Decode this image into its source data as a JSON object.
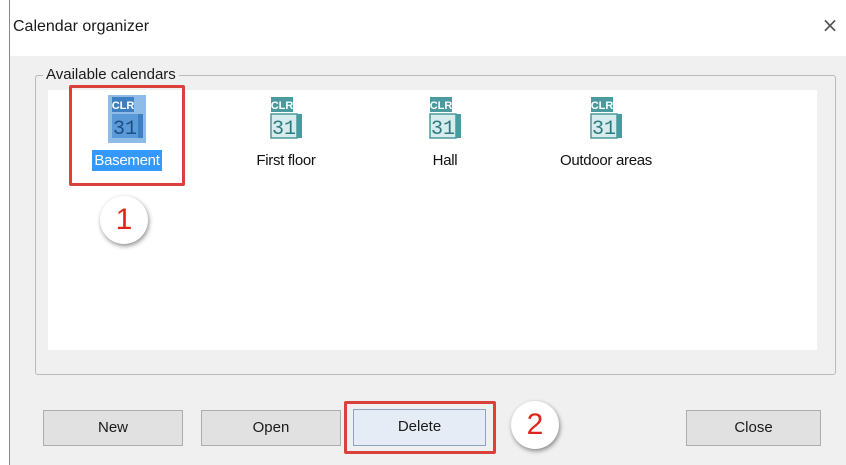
{
  "window": {
    "title": "Calendar organizer",
    "close_glyph": "×"
  },
  "group": {
    "legend": "Available calendars"
  },
  "calendars": [
    {
      "label": "Basement",
      "icon_top": "CLR",
      "icon_num": "31",
      "selected": true
    },
    {
      "label": "First floor",
      "icon_top": "CLR",
      "icon_num": "31",
      "selected": false
    },
    {
      "label": "Hall",
      "icon_top": "CLR",
      "icon_num": "31",
      "selected": false
    },
    {
      "label": "Outdoor areas",
      "icon_top": "CLR",
      "icon_num": "31",
      "selected": false
    }
  ],
  "buttons": {
    "new": "New",
    "open": "Open",
    "delete": "Delete",
    "close": "Close"
  },
  "annotations": {
    "step1": "1",
    "step2": "2"
  },
  "colors": {
    "selection": "#3399ff",
    "annotation_red": "#d9413a",
    "icon_teal": "#4a9a9f"
  },
  "icons": {
    "calendar": "calendar-icon",
    "close": "close-icon"
  }
}
